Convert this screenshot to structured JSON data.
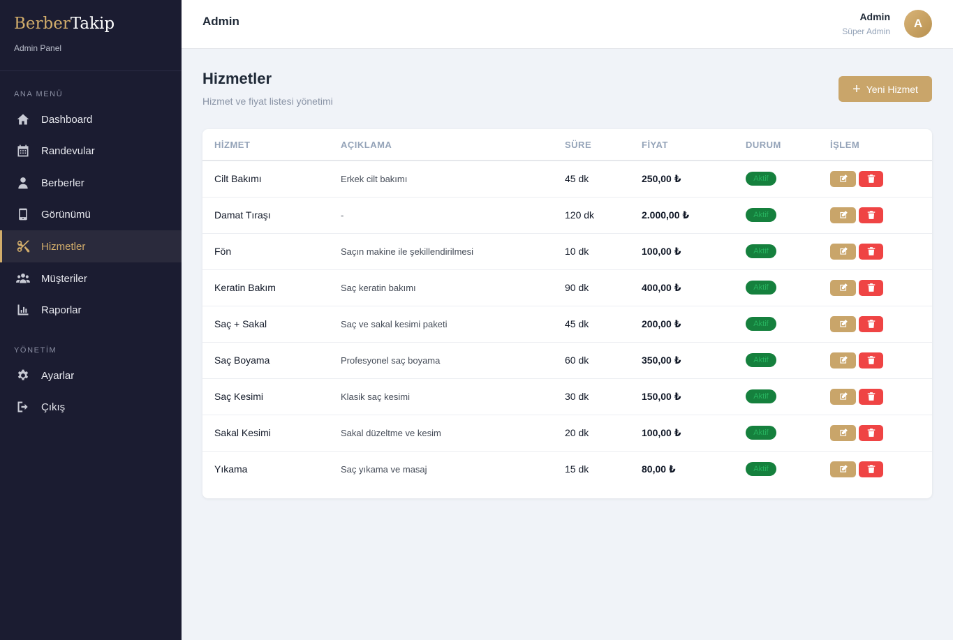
{
  "brand": {
    "part1": "Berber",
    "part2": "Takip",
    "subtitle": "Admin Panel"
  },
  "sidebar": {
    "section_main": "ANA MENÜ",
    "section_admin": "YÖNETİM",
    "items": [
      {
        "label": "Dashboard",
        "icon": "home-icon"
      },
      {
        "label": "Randevular",
        "icon": "calendar-icon"
      },
      {
        "label": "Berberler",
        "icon": "barber-icon"
      },
      {
        "label": "Görünümü",
        "icon": "mobile-icon"
      },
      {
        "label": "Hizmetler",
        "icon": "scissors-icon",
        "active": true
      },
      {
        "label": "Müşteriler",
        "icon": "users-icon"
      },
      {
        "label": "Raporlar",
        "icon": "chart-icon"
      }
    ],
    "admin_items": [
      {
        "label": "Ayarlar",
        "icon": "gear-icon"
      },
      {
        "label": "Çıkış",
        "icon": "logout-icon"
      }
    ]
  },
  "topbar": {
    "title": "Admin",
    "user_name": "Admin",
    "user_role": "Süper Admin",
    "avatar_letter": "A"
  },
  "page": {
    "title": "Hizmetler",
    "subtitle": "Hizmet ve fiyat listesi yönetimi",
    "new_button": "Yeni Hizmet"
  },
  "table": {
    "headers": [
      "HİZMET",
      "AÇIKLAMA",
      "SÜRE",
      "FİYAT",
      "DURUM",
      "İŞLEM"
    ],
    "rows": [
      {
        "name": "Cilt Bakımı",
        "desc": "Erkek cilt bakımı",
        "duration": "45 dk",
        "price": "250,00 ₺",
        "status": "Aktif"
      },
      {
        "name": "Damat Tıraşı",
        "desc": "-",
        "duration": "120 dk",
        "price": "2.000,00 ₺",
        "status": "Aktif"
      },
      {
        "name": "Fön",
        "desc": "Saçın makine ile şekillendirilmesi",
        "duration": "10 dk",
        "price": "100,00 ₺",
        "status": "Aktif"
      },
      {
        "name": "Keratin Bakım",
        "desc": "Saç keratin bakımı",
        "duration": "90 dk",
        "price": "400,00 ₺",
        "status": "Aktif"
      },
      {
        "name": "Saç + Sakal",
        "desc": "Saç ve sakal kesimi paketi",
        "duration": "45 dk",
        "price": "200,00 ₺",
        "status": "Aktif"
      },
      {
        "name": "Saç Boyama",
        "desc": "Profesyonel saç boyama",
        "duration": "60 dk",
        "price": "350,00 ₺",
        "status": "Aktif"
      },
      {
        "name": "Saç Kesimi",
        "desc": "Klasik saç kesimi",
        "duration": "30 dk",
        "price": "150,00 ₺",
        "status": "Aktif"
      },
      {
        "name": "Sakal Kesimi",
        "desc": "Sakal düzeltme ve kesim",
        "duration": "20 dk",
        "price": "100,00 ₺",
        "status": "Aktif"
      },
      {
        "name": "Yıkama",
        "desc": "Saç yıkama ve masaj",
        "duration": "15 dk",
        "price": "80,00 ₺",
        "status": "Aktif"
      }
    ]
  },
  "colors": {
    "accent": "#c9a56a",
    "sidebar_bg": "#1b1c31",
    "danger": "#ef4444",
    "success": "#15803d"
  }
}
